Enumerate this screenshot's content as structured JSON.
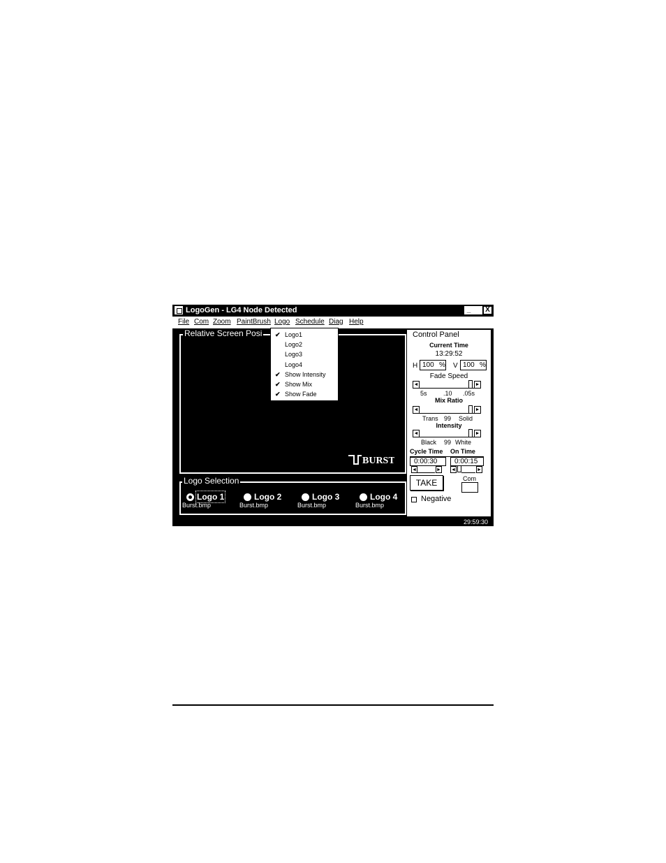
{
  "window": {
    "title": "LogoGen - LG4 Node Detected",
    "minimize_glyph": "_",
    "maximize_glyph": "",
    "close_glyph": "X"
  },
  "menubar": {
    "items": [
      "File",
      "Com",
      "Zoom",
      "PaintBrush",
      "Logo",
      "Schedule",
      "Diag",
      "Help"
    ]
  },
  "logo_menu": {
    "items": [
      {
        "label": "Logo1",
        "checked": true
      },
      {
        "label": "Logo2",
        "checked": false
      },
      {
        "label": "Logo3",
        "checked": false
      },
      {
        "label": "Logo4",
        "checked": false
      },
      {
        "label": "Show Intensity",
        "checked": true
      },
      {
        "label": "Show Mix",
        "checked": true
      },
      {
        "label": "Show Fade",
        "checked": true
      }
    ],
    "check_glyph": "✔"
  },
  "screen_panel": {
    "legend": "Relative Screen Posi",
    "logo_text": "BURST"
  },
  "logo_selection": {
    "legend": "Logo Selection",
    "options": [
      {
        "label": "Logo 1",
        "file": "Burst.bmp",
        "selected": true
      },
      {
        "label": "Logo 2",
        "file": "Burst.bmp",
        "selected": false
      },
      {
        "label": "Logo 3",
        "file": "Burst.bmp",
        "selected": false
      },
      {
        "label": "Logo 4",
        "file": "Burst.bmp",
        "selected": false
      }
    ]
  },
  "control_panel": {
    "title": "Control Panel",
    "current_time_label": "Current Time",
    "current_time": "13:29:52",
    "h_label": "H",
    "h_value": "100",
    "v_label": "V",
    "v_value": "100",
    "percent": "%",
    "fade_speed_label": "Fade Speed",
    "fade_ticks": [
      "5s",
      ".10",
      ".05s"
    ],
    "mix_ratio_label": "Mix Ratio",
    "mix_ticks": [
      "Trans",
      "99",
      "Solid"
    ],
    "intensity_label": "Intensity",
    "intensity_ticks": [
      "Black",
      "99",
      "White"
    ],
    "cycle_time_label": "Cycle Time",
    "on_time_label": "On Time",
    "cycle_time": "0:00:30",
    "on_time": "0:00:15",
    "take_label": "TAKE",
    "com_label": "Com",
    "negative_label": "Negative",
    "negative_checked": false,
    "arrow_left": "◄",
    "arrow_right": "►"
  },
  "status": {
    "time": "29:59:30"
  }
}
